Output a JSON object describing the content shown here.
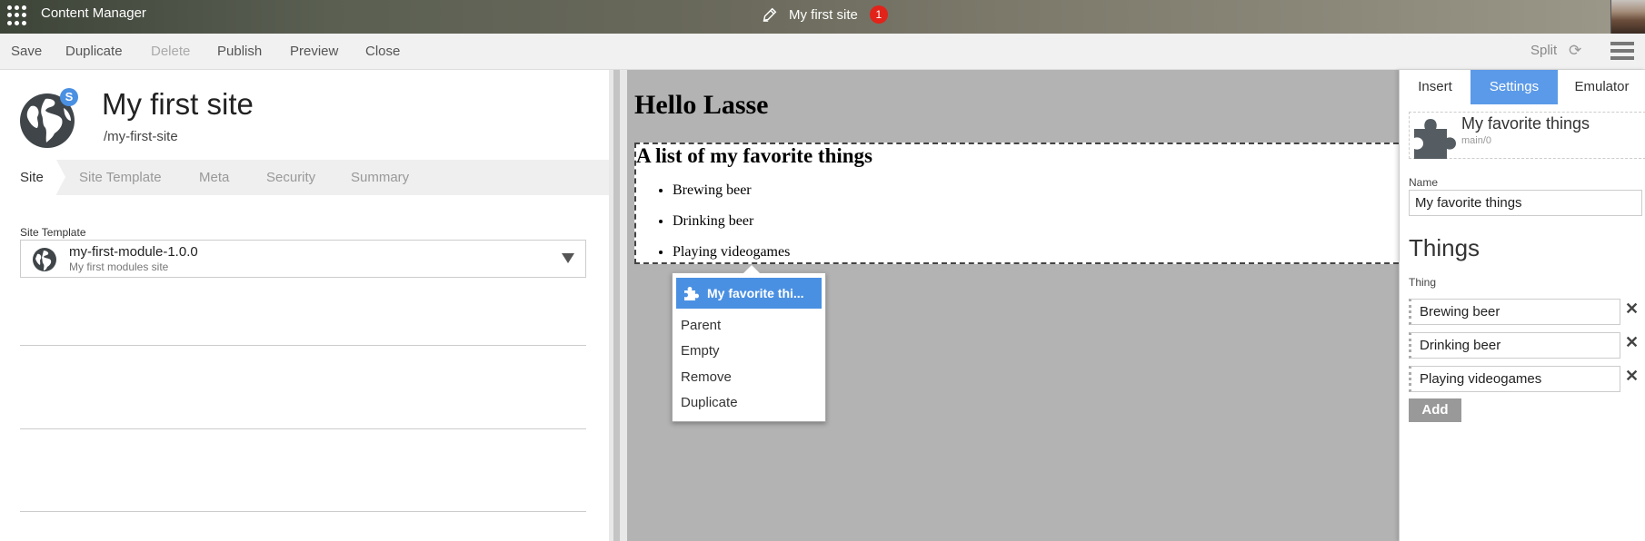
{
  "header": {
    "app_title": "Content Manager",
    "site_name": "My first site",
    "notification_count": "1",
    "icons": [
      "apps-grid-icon",
      "pen-icon",
      "user-avatar"
    ]
  },
  "toolbar": {
    "save": "Save",
    "duplicate": "Duplicate",
    "delete": "Delete",
    "publish": "Publish",
    "preview": "Preview",
    "close": "Close",
    "split": "Split",
    "refresh_icon": "refresh-icon",
    "menu_icon": "hamburger-menu-icon"
  },
  "site": {
    "badge": "S",
    "title": "My first site",
    "path_prefix": "/",
    "path": "my-first-site"
  },
  "tabs": [
    "Site",
    "Site Template",
    "Meta",
    "Security",
    "Summary"
  ],
  "site_template": {
    "label": "Site Template",
    "value": "my-first-module-1.0.0",
    "description": "My first modules site"
  },
  "preview": {
    "heading": "Hello Lasse",
    "module_heading": "A list of my favorite things",
    "items": [
      "Brewing beer",
      "Drinking beer",
      "Playing videogames"
    ]
  },
  "context_menu": {
    "title": "My favorite thi...",
    "items": [
      "Parent",
      "Empty",
      "Remove",
      "Duplicate"
    ]
  },
  "settings_panel": {
    "tabs": [
      "Insert",
      "Settings",
      "Emulator"
    ],
    "active_tab": "Settings",
    "module_name": "My favorite things",
    "module_path": "main/0",
    "name_label": "Name",
    "name_value": "My favorite things",
    "things_heading": "Things",
    "thing_label": "Thing",
    "things": [
      "Brewing beer",
      "Drinking beer",
      "Playing videogames"
    ],
    "remove_glyph": "✕",
    "add_label": "Add"
  },
  "colors": {
    "accent": "#4a90e2",
    "settings_tab": "#5b9ae8",
    "badge_red": "#e2231a",
    "preview_bg": "#b3b3b3"
  }
}
